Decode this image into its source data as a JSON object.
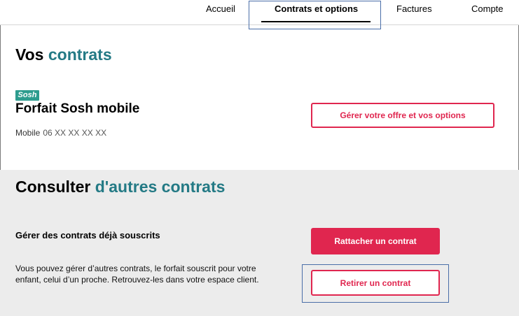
{
  "nav": {
    "items": [
      {
        "label": "Accueil",
        "active": false
      },
      {
        "label": "Contrats et options",
        "active": true
      },
      {
        "label": "Factures",
        "active": false
      },
      {
        "label": "Compte",
        "active": false
      }
    ]
  },
  "contracts": {
    "title_prefix": "Vos",
    "title_accent": "contrats",
    "brand_logo": "Sosh",
    "offer_name": "Forfait Sosh mobile",
    "line_label": "Mobile",
    "line_number": "06 XX XX XX XX",
    "manage_button": "Gérer votre offre et vos options"
  },
  "other": {
    "title_prefix": "Consulter",
    "title_accent": "d'autres contrats",
    "subtitle": "Gérer des contrats déjà souscrits",
    "description": "Vous pouvez gérer d’autres contrats, le forfait souscrit pour votre enfant, celui d’un proche. Retrouvez-les dans votre espace client.",
    "attach_button": "Rattacher un contrat",
    "remove_button": "Retirer un contrat"
  },
  "colors": {
    "accent_teal": "#247a85",
    "brand_pink": "#e0264f",
    "sosh_green": "#2d9c8e",
    "focus_blue": "#4a6ea8",
    "grey_section": "#ececec"
  }
}
